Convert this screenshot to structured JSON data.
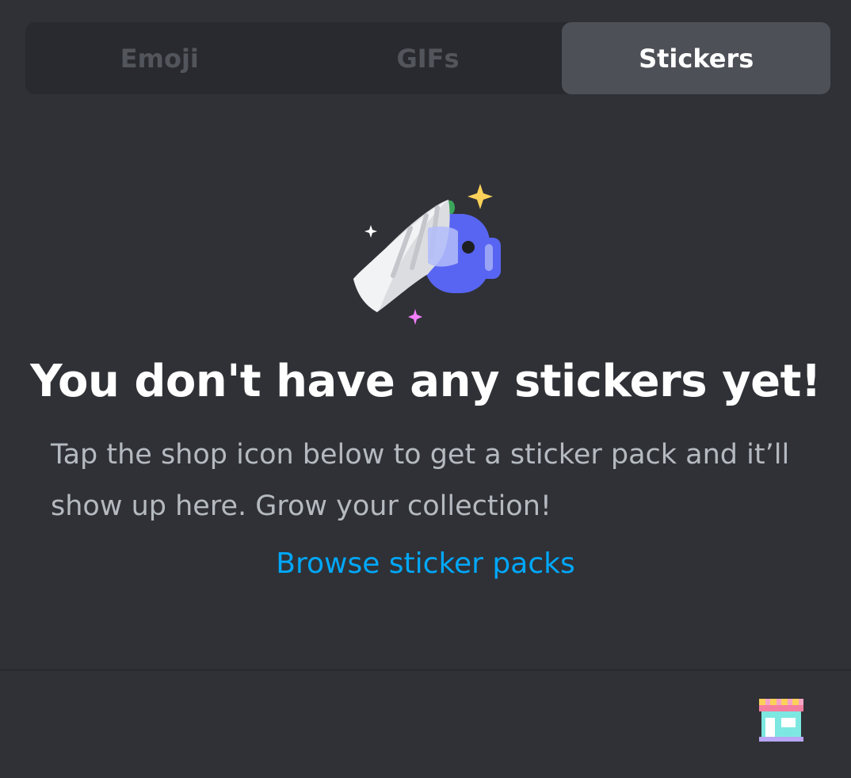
{
  "tabs": [
    {
      "label": "Emoji",
      "active": false
    },
    {
      "label": "GIFs",
      "active": false
    },
    {
      "label": "Stickers",
      "active": true
    }
  ],
  "empty_state": {
    "illustration_icon": "wumpus-sticker-peel-icon",
    "headline": "You don't have any stickers yet!",
    "description": "Tap the shop icon below to get a sticker pack and it’ll show up here. Grow your collection!",
    "browse_link": "Browse sticker packs"
  },
  "footer": {
    "shop_icon": "shop-icon"
  },
  "colors": {
    "background": "#303136",
    "tab_bar": "#292a2f",
    "tab_active": "#4e5058",
    "link": "#00a8fc",
    "blurple": "#5865f2"
  }
}
